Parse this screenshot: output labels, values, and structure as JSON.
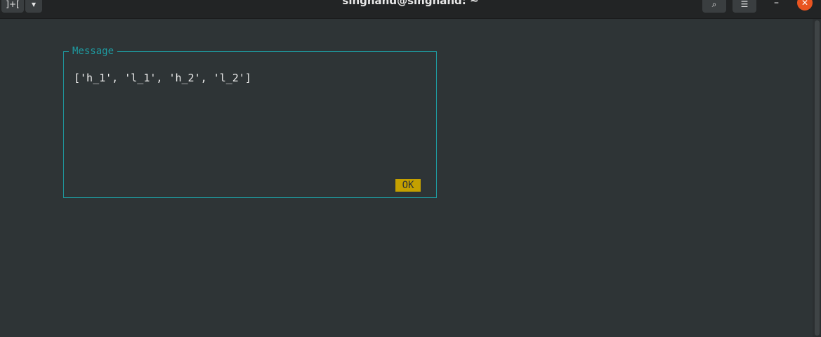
{
  "window": {
    "title": "singhand@singhand: ~",
    "new_tab_glyph": "]+[",
    "dropdown_glyph": "▾",
    "search_glyph": "⌕",
    "menu_glyph": "☰",
    "minimize_glyph": "–",
    "close_glyph": "✕"
  },
  "dialog": {
    "title": "Message",
    "message": "['h_1', 'l_1', 'h_2', 'l_2']",
    "ok_label": "OK"
  },
  "colors": {
    "background": "#2e3436",
    "border": "#1e9aa0",
    "ok_button": "#c4a000",
    "close_button": "#e95420"
  }
}
